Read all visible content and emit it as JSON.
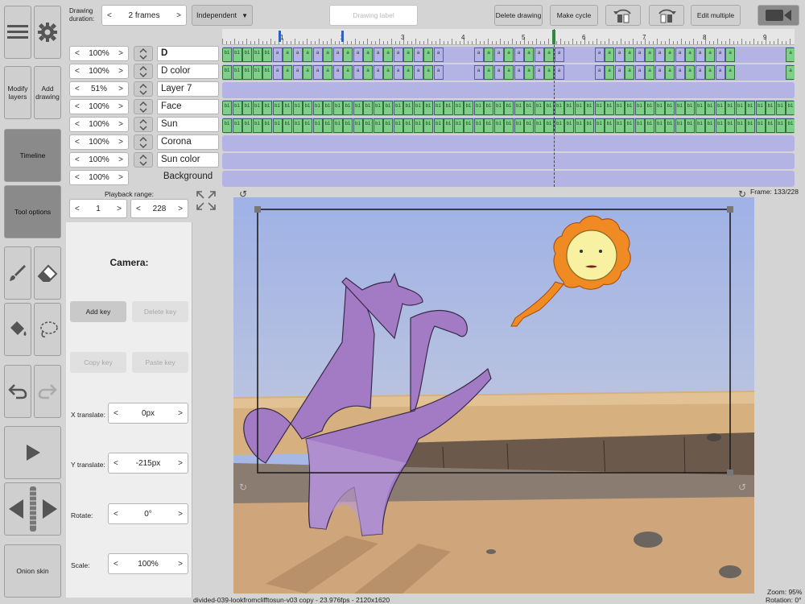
{
  "toolbar": {
    "drawing_duration_label": "Drawing duration:",
    "duration_value": "2 frames",
    "mode_label": "Independent",
    "drawing_label_placeholder": "Drawing label",
    "delete_drawing_label": "Delete drawing",
    "make_cycle_label": "Make cycle",
    "edit_multiple_label": "Edit multiple"
  },
  "left_tools": {
    "modify_layers_label": "Modify layers",
    "add_drawing_label": "Add drawing",
    "timeline_label": "Timeline",
    "tool_options_label": "Tool options",
    "onion_skin_label": "Onion skin"
  },
  "ruler": {
    "labels": [
      "1",
      "2",
      "3",
      "4",
      "5",
      "6",
      "7",
      "8",
      "9"
    ]
  },
  "layers": [
    {
      "zoom": "100%",
      "name": "D"
    },
    {
      "zoom": "100%",
      "name": "D color"
    },
    {
      "zoom": "51%",
      "name": "Layer 7"
    },
    {
      "zoom": "100%",
      "name": "Face"
    },
    {
      "zoom": "100%",
      "name": "Sun"
    },
    {
      "zoom": "100%",
      "name": "Corona"
    },
    {
      "zoom": "100%",
      "name": "Sun color"
    },
    {
      "zoom": "100%",
      "name": "Background"
    }
  ],
  "cell_labels": {
    "a": "a",
    "b1": "b1"
  },
  "playback": {
    "label": "Playback range:",
    "start": "1",
    "end": "228"
  },
  "camera": {
    "title": "Camera:",
    "add_key": "Add key",
    "delete_key": "Delete key",
    "copy_key": "Copy key",
    "paste_key": "Paste key",
    "x_translate_label": "X translate:",
    "x_translate_value": "0px",
    "y_translate_label": "Y translate:",
    "y_translate_value": "-215px",
    "rotate_label": "Rotate:",
    "rotate_value": "0°",
    "scale_label": "Scale:",
    "scale_value": "100%"
  },
  "status": {
    "frame": "Frame: 133/228",
    "zoom": "Zoom: 95%",
    "rotation": "Rotation: 0°",
    "file_info": "divided-039-lookfromclifftosun-v03 copy - 23.976fps - 2120x1620"
  },
  "arrows": {
    "left": "<",
    "right": ">"
  }
}
